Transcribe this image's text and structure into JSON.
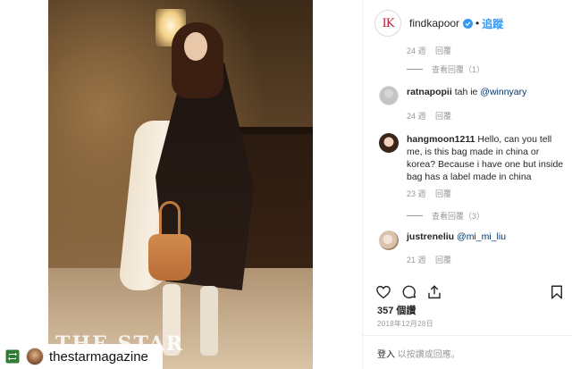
{
  "post": {
    "account": "findkapoor",
    "follow_label": "追蹤",
    "separator": "•",
    "brand_avatar_text": "IK"
  },
  "credit": {
    "username": "thestarmagazine",
    "watermark": "THE STAR"
  },
  "thread": {
    "top_meta": {
      "age": "24 週",
      "reply": "回覆"
    },
    "top_view_replies": "查看回覆（1）",
    "comments": [
      {
        "user": "ratnapopii",
        "text_before": "tah ie ",
        "mention": "@winnyary",
        "age": "24 週",
        "reply": "回覆"
      },
      {
        "user": "hangmoon1211",
        "text": "Hello, can you tell me, is this bag made in china or korea? Because i have one but inside bag has a label made in china",
        "age": "23 週",
        "reply": "回覆",
        "view_replies": "查看回覆（3）"
      },
      {
        "user": "justreneliu",
        "text_before": "",
        "mention": "@mi_mi_liu",
        "age": "21 週",
        "reply": "回覆"
      }
    ]
  },
  "actions": {
    "icons": [
      "heart-icon",
      "comment-icon",
      "share-icon",
      "bookmark-icon"
    ]
  },
  "likes": "357 個讚",
  "date": "2018年12月28日",
  "login": {
    "link": "登入",
    "rest": "以按讚或回應。"
  }
}
